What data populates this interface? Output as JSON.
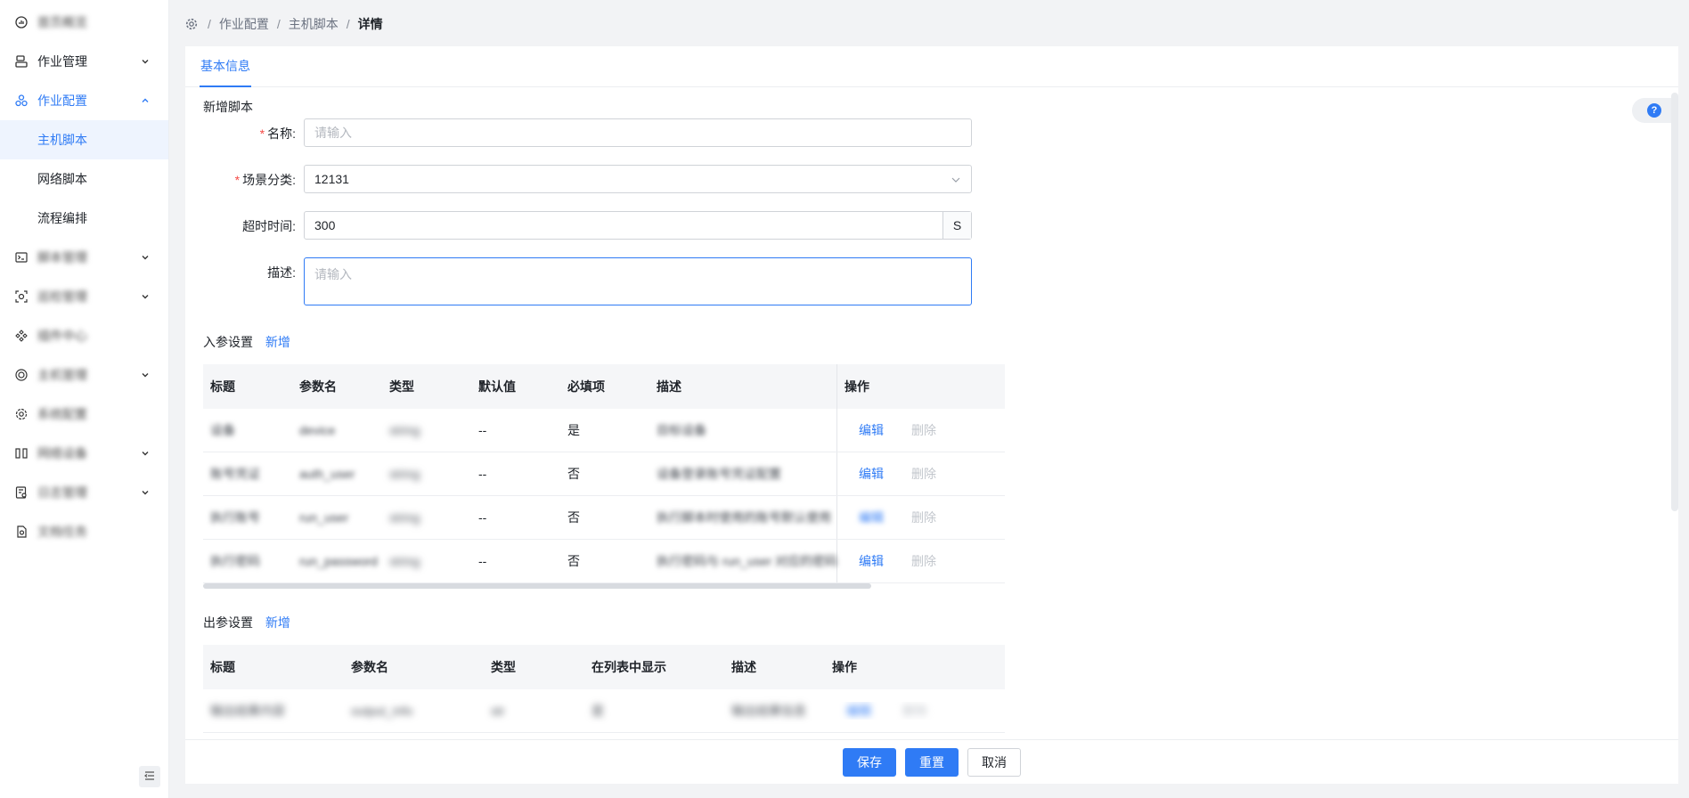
{
  "sidebar": {
    "items": [
      {
        "label": "首页概览",
        "icon": "dashboard-icon",
        "blurred": true
      },
      {
        "label": "作业管理",
        "icon": "job-icon",
        "blurred": false
      },
      {
        "label": "作业配置",
        "icon": "config-icon",
        "blurred": false
      },
      {
        "label": "主机脚本"
      },
      {
        "label": "网络脚本"
      },
      {
        "label": "流程编排"
      },
      {
        "label": "脚本管理",
        "icon": "terminal-icon",
        "blurred": true
      },
      {
        "label": "巡检管理",
        "icon": "scan-icon",
        "blurred": true
      },
      {
        "label": "插件中心",
        "icon": "plugin-icon",
        "blurred": true
      },
      {
        "label": "主机管理",
        "icon": "target-icon",
        "blurred": true
      },
      {
        "label": "系统配置",
        "icon": "settings-icon",
        "blurred": true
      },
      {
        "label": "网络设备",
        "icon": "network-icon",
        "blurred": true
      },
      {
        "label": "日志管理",
        "icon": "log-icon",
        "blurred": true
      },
      {
        "label": "文档任务",
        "icon": "doc-icon",
        "blurred": true
      }
    ]
  },
  "breadcrumb": {
    "items": [
      "作业配置",
      "主机脚本",
      "详情"
    ],
    "separator": "/"
  },
  "tabs": [
    "基本信息"
  ],
  "help_label": "?",
  "form": {
    "section_title": "新增脚本",
    "name_label": "名称:",
    "name_placeholder": "请输入",
    "scene_label": "场景分类:",
    "scene_value": "12131",
    "timeout_label": "超时时间:",
    "timeout_value": "300",
    "timeout_unit": "S",
    "desc_label": "描述:",
    "desc_placeholder": "请输入"
  },
  "in_params": {
    "title": "入参设置",
    "add_label": "新增",
    "columns": [
      "标题",
      "参数名",
      "类型",
      "默认值",
      "必填项",
      "描述",
      "操作"
    ],
    "rows": [
      {
        "title": "设备",
        "name": "device",
        "type": "string",
        "default": "--",
        "required": "是",
        "desc": "目标设备",
        "edit": "编辑",
        "delete": "删除"
      },
      {
        "title": "账号凭证",
        "name": "auth_user",
        "type": "string",
        "default": "--",
        "required": "否",
        "desc": "设备登录账号凭证配置",
        "edit": "编辑",
        "delete": "删除"
      },
      {
        "title": "执行账号",
        "name": "run_user",
        "type": "string",
        "default": "--",
        "required": "否",
        "desc": "执行脚本时使用的账号默认使用",
        "edit": "编辑",
        "delete": "删除"
      },
      {
        "title": "执行密码",
        "name": "run_password",
        "type": "string",
        "default": "--",
        "required": "否",
        "desc": "执行密码与 run_user 对应的密码",
        "edit": "编辑",
        "delete": "删除"
      }
    ]
  },
  "out_params": {
    "title": "出参设置",
    "add_label": "新增",
    "columns": [
      "标题",
      "参数名",
      "类型",
      "在列表中显示",
      "描述",
      "操作"
    ],
    "rows": [
      {
        "title": "输出结果内容",
        "name": "output_info",
        "type": "str",
        "show": "是",
        "desc": "输出结果信息",
        "edit": "编辑",
        "delete": "删除"
      }
    ]
  },
  "footer": {
    "save": "保存",
    "reset": "重置",
    "cancel": "取消"
  },
  "colors": {
    "accent": "#2f7bf5",
    "required": "#f54a45",
    "page_bg": "#f2f3f5"
  }
}
